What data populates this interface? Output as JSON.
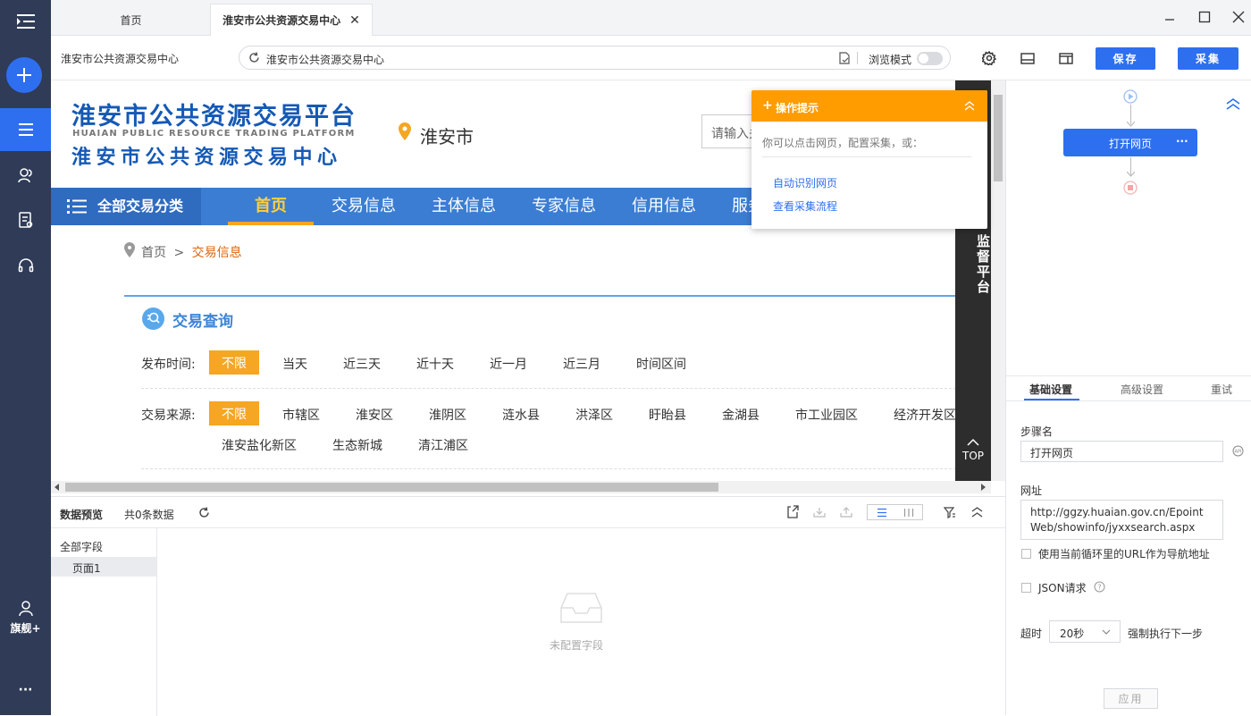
{
  "rail": {
    "items": [
      {
        "icon": "collapse-menu-icon"
      },
      {
        "icon": "plus-icon"
      },
      {
        "icon": "task-list-icon"
      },
      {
        "icon": "users-icon"
      },
      {
        "icon": "document-icon"
      },
      {
        "icon": "headset-icon"
      }
    ],
    "profile_label": "旗舰+",
    "more_label": "···"
  },
  "tabs": [
    {
      "label": "首页"
    },
    {
      "label": "淮安市公共资源交易中心",
      "close": "✕"
    }
  ],
  "addr": {
    "page_title": "淮安市公共资源交易中心",
    "url_text": "淮安市公共资源交易中心",
    "browse_mode_label": "浏览模式",
    "save_label": "保存",
    "collect_label": "采集"
  },
  "web": {
    "logo_cn": "淮安市公共资源交易平台",
    "logo_en": "HUAIAN PUBLIC RESOURCE TRADING PLATFORM",
    "logo_cn2": "淮安市公共资源交易中心",
    "city": "淮安市",
    "search_placeholder": "请输入关",
    "all_categories": "全部交易分类",
    "nav": [
      "首页",
      "交易信息",
      "主体信息",
      "专家信息",
      "信用信息",
      "服务"
    ],
    "breadcrumb_home": "首页",
    "breadcrumb_sep": ">",
    "breadcrumb_current": "交易信息",
    "section_title": "交易查询",
    "time_label": "发布时间:",
    "time_options": [
      "不限",
      "当天",
      "近三天",
      "近十天",
      "近一月",
      "近三月",
      "时间区间"
    ],
    "source_label": "交易来源:",
    "source_options": [
      "不限",
      "市辖区",
      "淮安区",
      "淮阴区",
      "涟水县",
      "洪泽区",
      "盱眙县",
      "金湖县",
      "市工业园区",
      "经济开发区"
    ],
    "source_options2": [
      "淮安盐化新区",
      "生态新城",
      "清江浦区"
    ],
    "side_panel": "监督平台",
    "top_label": "TOP"
  },
  "tip": {
    "title": "操作提示",
    "desc": "你可以点击网页，配置采集，或：",
    "link1": "自动识别网页",
    "link2": "查看采集流程"
  },
  "flow": {
    "step_label": "打开网页",
    "more": "···"
  },
  "settings": {
    "tabs": [
      "基础设置",
      "高级设置",
      "重试"
    ],
    "step_name_label": "步骤名",
    "step_name_value": "打开网页",
    "url_label": "网址",
    "url_value": "http://ggzy.huaian.gov.cn/EpointWeb/showinfo/jyxxsearch.aspx",
    "use_loop_url": "使用当前循环里的URL作为导航地址",
    "json_request": "JSON请求",
    "timeout_label": "超时",
    "timeout_value": "20秒",
    "force_next": "强制执行下一步",
    "apply": "应用"
  },
  "preview": {
    "title": "数据预览",
    "count": "共0条数据",
    "all_fields": "全部字段",
    "page1": "页面1",
    "empty": "未配置字段"
  },
  "colors": {
    "rail": "#2f3b57",
    "accent": "#2e6ff0",
    "nav": "#3b7dd3",
    "orange": "#f5a623",
    "tip_header": "#ff9c00"
  }
}
